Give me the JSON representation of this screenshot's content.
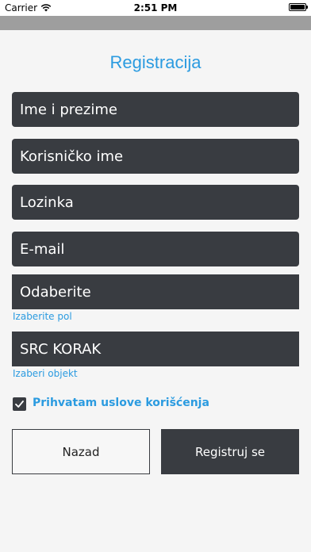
{
  "status_bar": {
    "carrier": "Carrier",
    "time": "2:51 PM"
  },
  "title": "Registracija",
  "fields": {
    "full_name_placeholder": "Ime i prezime",
    "username_placeholder": "Korisničko ime",
    "password_placeholder": "Lozinka",
    "email_placeholder": "E-mail",
    "gender_value": "Odaberite",
    "gender_hint": "Izaberite pol",
    "facility_value": "SRC KORAK",
    "facility_hint": "Izaberi objekt"
  },
  "terms": {
    "checked": true,
    "label": "Prihvatam uslove korišćenja"
  },
  "buttons": {
    "back": "Nazad",
    "register": "Registruj se"
  },
  "colors": {
    "accent": "#2b9be0",
    "field_bg": "#393c41",
    "top_bar": "#9e9e9e",
    "background": "#f5f5f5"
  }
}
